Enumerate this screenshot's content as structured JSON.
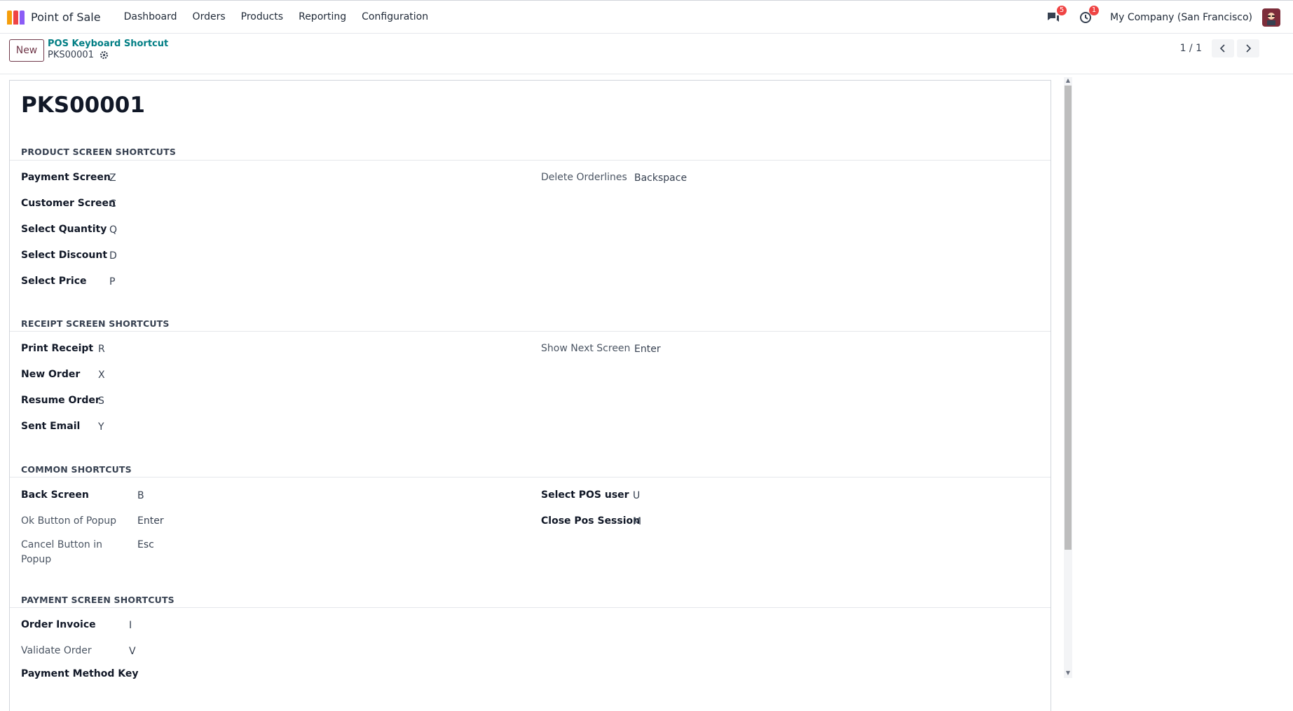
{
  "nav": {
    "app_name": "Point of Sale",
    "menu": [
      "Dashboard",
      "Orders",
      "Products",
      "Reporting",
      "Configuration"
    ],
    "messages_count": "5",
    "activities_count": "1",
    "company": "My Company (San Francisco)",
    "logo_colors": [
      "#f59e0b",
      "#ef4444",
      "#8b5cf6"
    ]
  },
  "control": {
    "new_label": "New",
    "breadcrumb": "POS Keyboard Shortcut",
    "record": "PKS00001",
    "pager": "1 / 1"
  },
  "form": {
    "title": "PKS00001",
    "sections": {
      "product": "PRODUCT SCREEN SHORTCUTS",
      "receipt": "RECEIPT SCREEN SHORTCUTS",
      "common": "COMMON SHORTCUTS",
      "payment": "PAYMENT SCREEN SHORTCUTS"
    },
    "product_left": [
      {
        "label": "Payment Screen",
        "value": "Z"
      },
      {
        "label": "Customer Screen",
        "value": "C"
      },
      {
        "label": "Select Quantity",
        "value": "Q"
      },
      {
        "label": "Select Discount",
        "value": "D"
      },
      {
        "label": "Select Price",
        "value": "P"
      }
    ],
    "product_right": [
      {
        "label": "Delete Orderlines",
        "value": "Backspace"
      }
    ],
    "receipt_left": [
      {
        "label": "Print Receipt",
        "value": "R"
      },
      {
        "label": "New Order",
        "value": "X"
      },
      {
        "label": "Resume Order",
        "value": "S"
      },
      {
        "label": "Sent Email",
        "value": "Y"
      }
    ],
    "receipt_right": [
      {
        "label": "Show Next Screen",
        "value": "Enter"
      }
    ],
    "common_left": [
      {
        "label": "Back Screen",
        "value": "B"
      },
      {
        "label": "Ok Button of Popup",
        "value": "Enter"
      },
      {
        "label": "Cancel Button in",
        "label2": "Popup",
        "value": "Esc"
      }
    ],
    "common_right": [
      {
        "label": "Select POS user",
        "value": "U"
      },
      {
        "label": "Close Pos Session",
        "value": "M"
      }
    ],
    "payment_left": [
      {
        "label": "Order Invoice",
        "value": "I"
      },
      {
        "label": "Validate Order",
        "value": "V"
      },
      {
        "label": "Payment Method Key"
      }
    ]
  }
}
